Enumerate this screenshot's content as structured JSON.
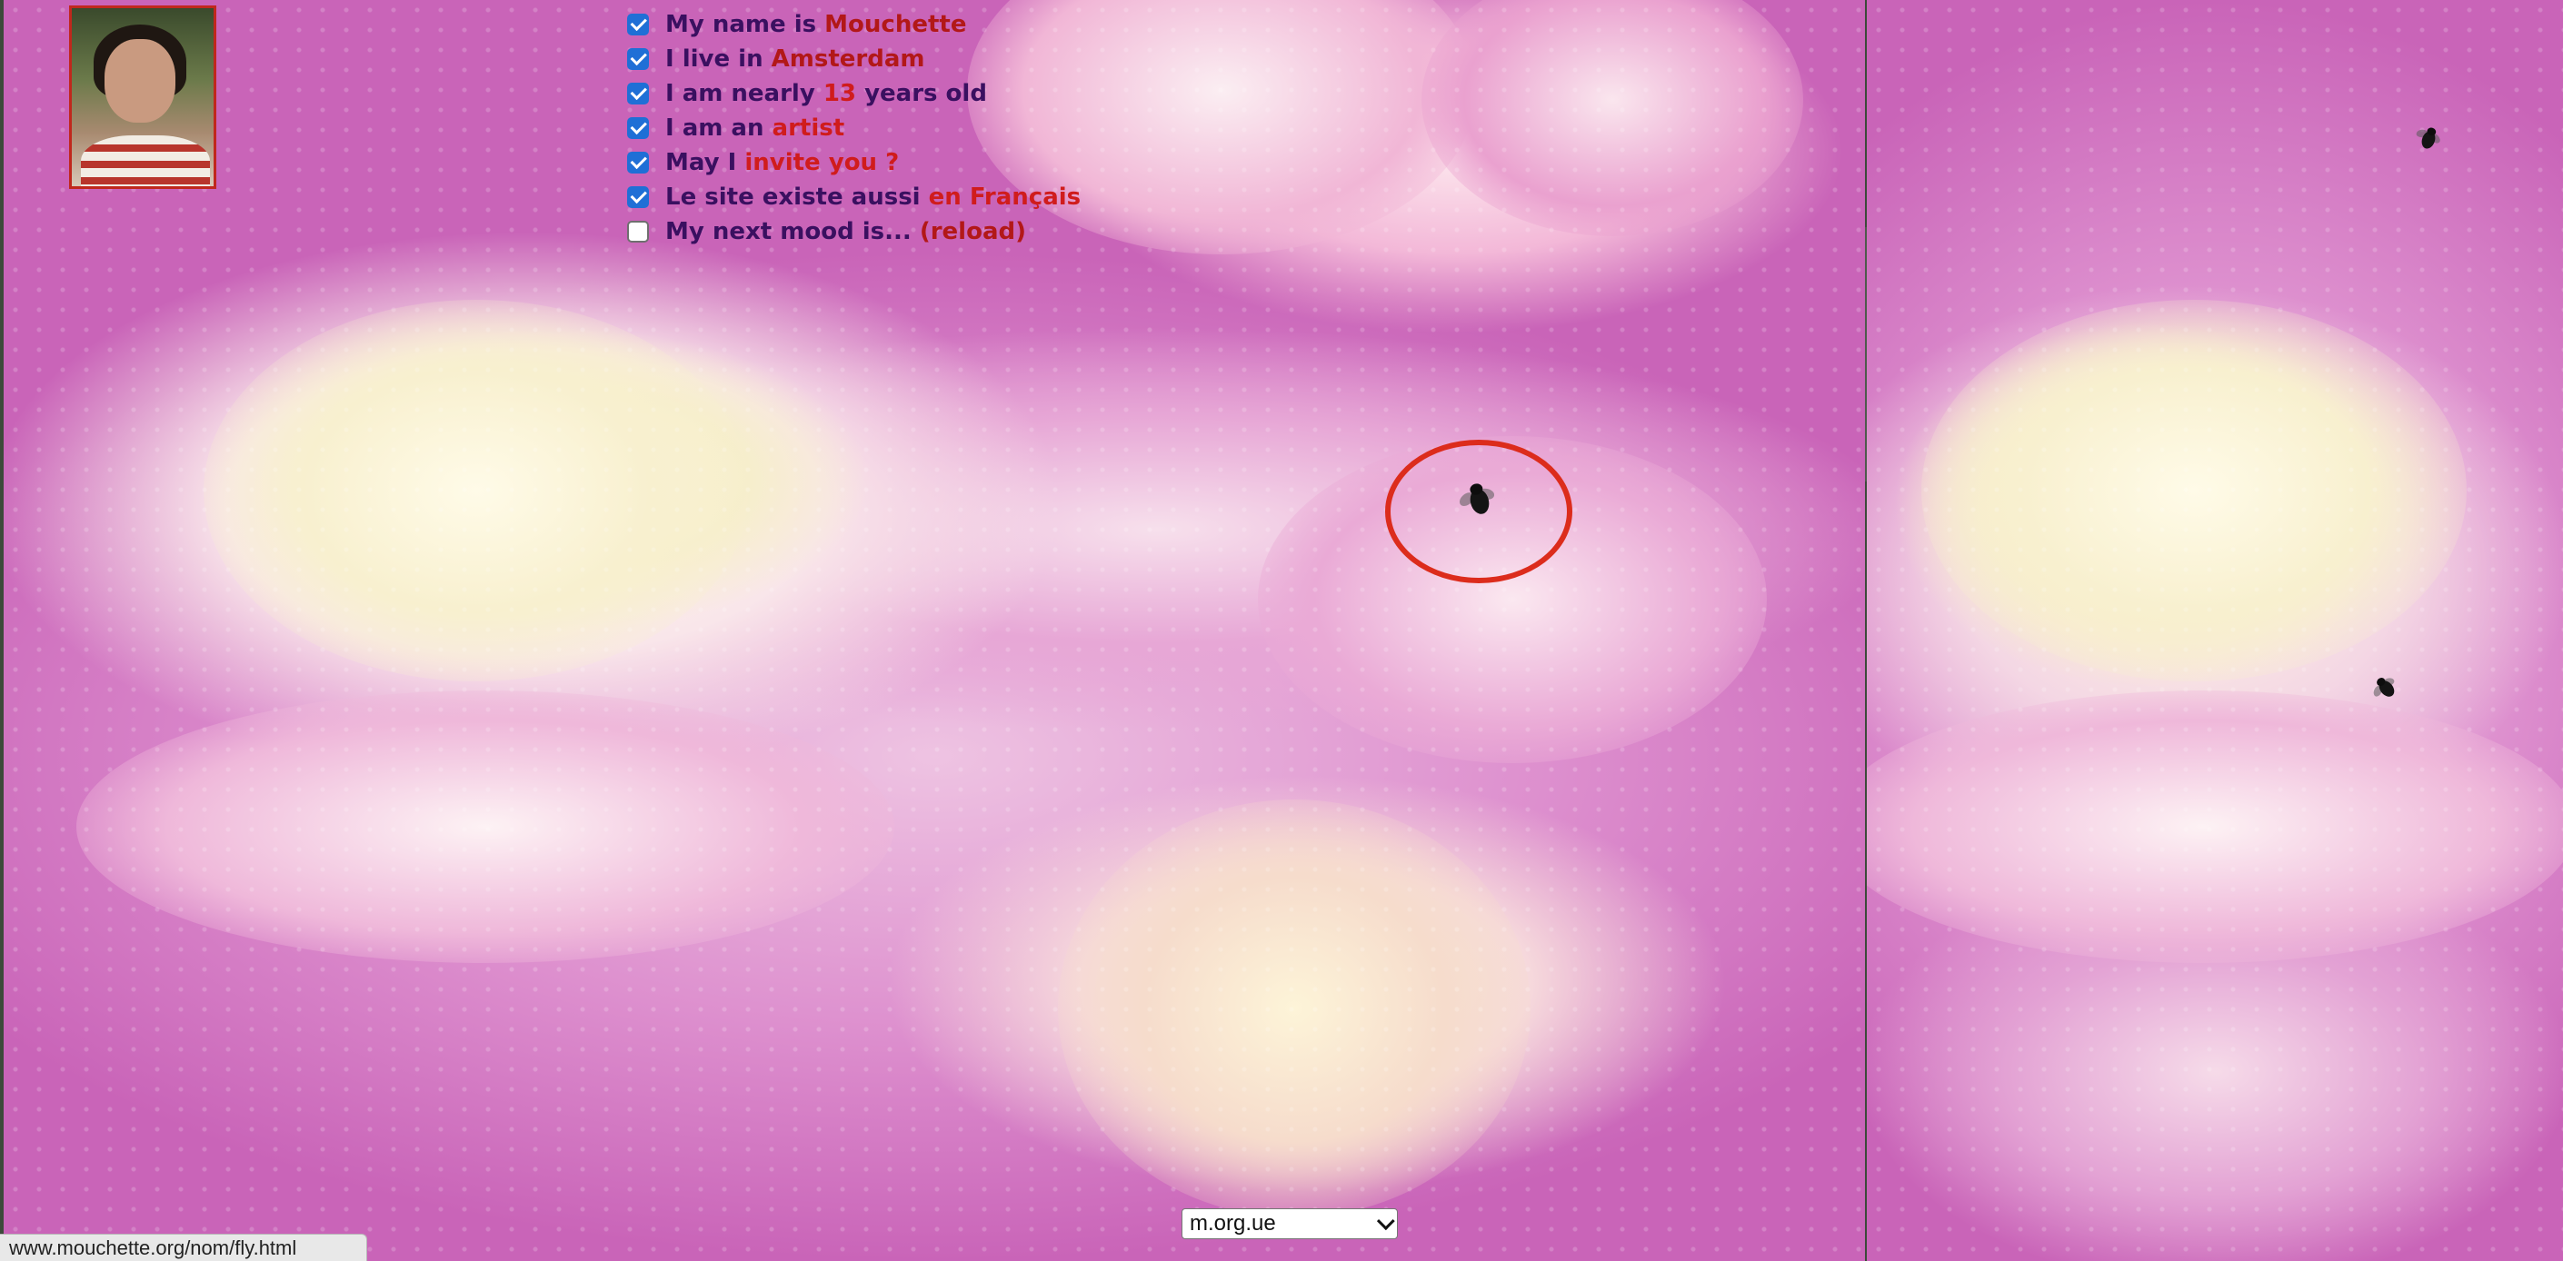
{
  "profile": {
    "avatar_alt": "Mouchette portrait"
  },
  "menu": [
    {
      "checked": true,
      "text": "My name is ",
      "link": "Mouchette"
    },
    {
      "checked": true,
      "text": "I live in ",
      "link": "Amsterdam"
    },
    {
      "checked": true,
      "text": "I am nearly ",
      "link": "13",
      "after": " years old"
    },
    {
      "checked": true,
      "text": "I am an ",
      "link": "artist"
    },
    {
      "checked": true,
      "text": "May I ",
      "link": "invite you ?"
    },
    {
      "checked": true,
      "text": "Le site existe aussi ",
      "link": "en Français"
    },
    {
      "checked": false,
      "text": "My next mood is... ",
      "link": "(reload)"
    }
  ],
  "site_select": {
    "selected": "m.org.ue"
  },
  "status_bar": {
    "url": "www.mouchette.org/nom/fly.html"
  },
  "colors": {
    "text": "#3a1060",
    "highlight": "#d01c1c",
    "ring": "#dc2c1c",
    "checkbox": "#1f6fd6"
  }
}
